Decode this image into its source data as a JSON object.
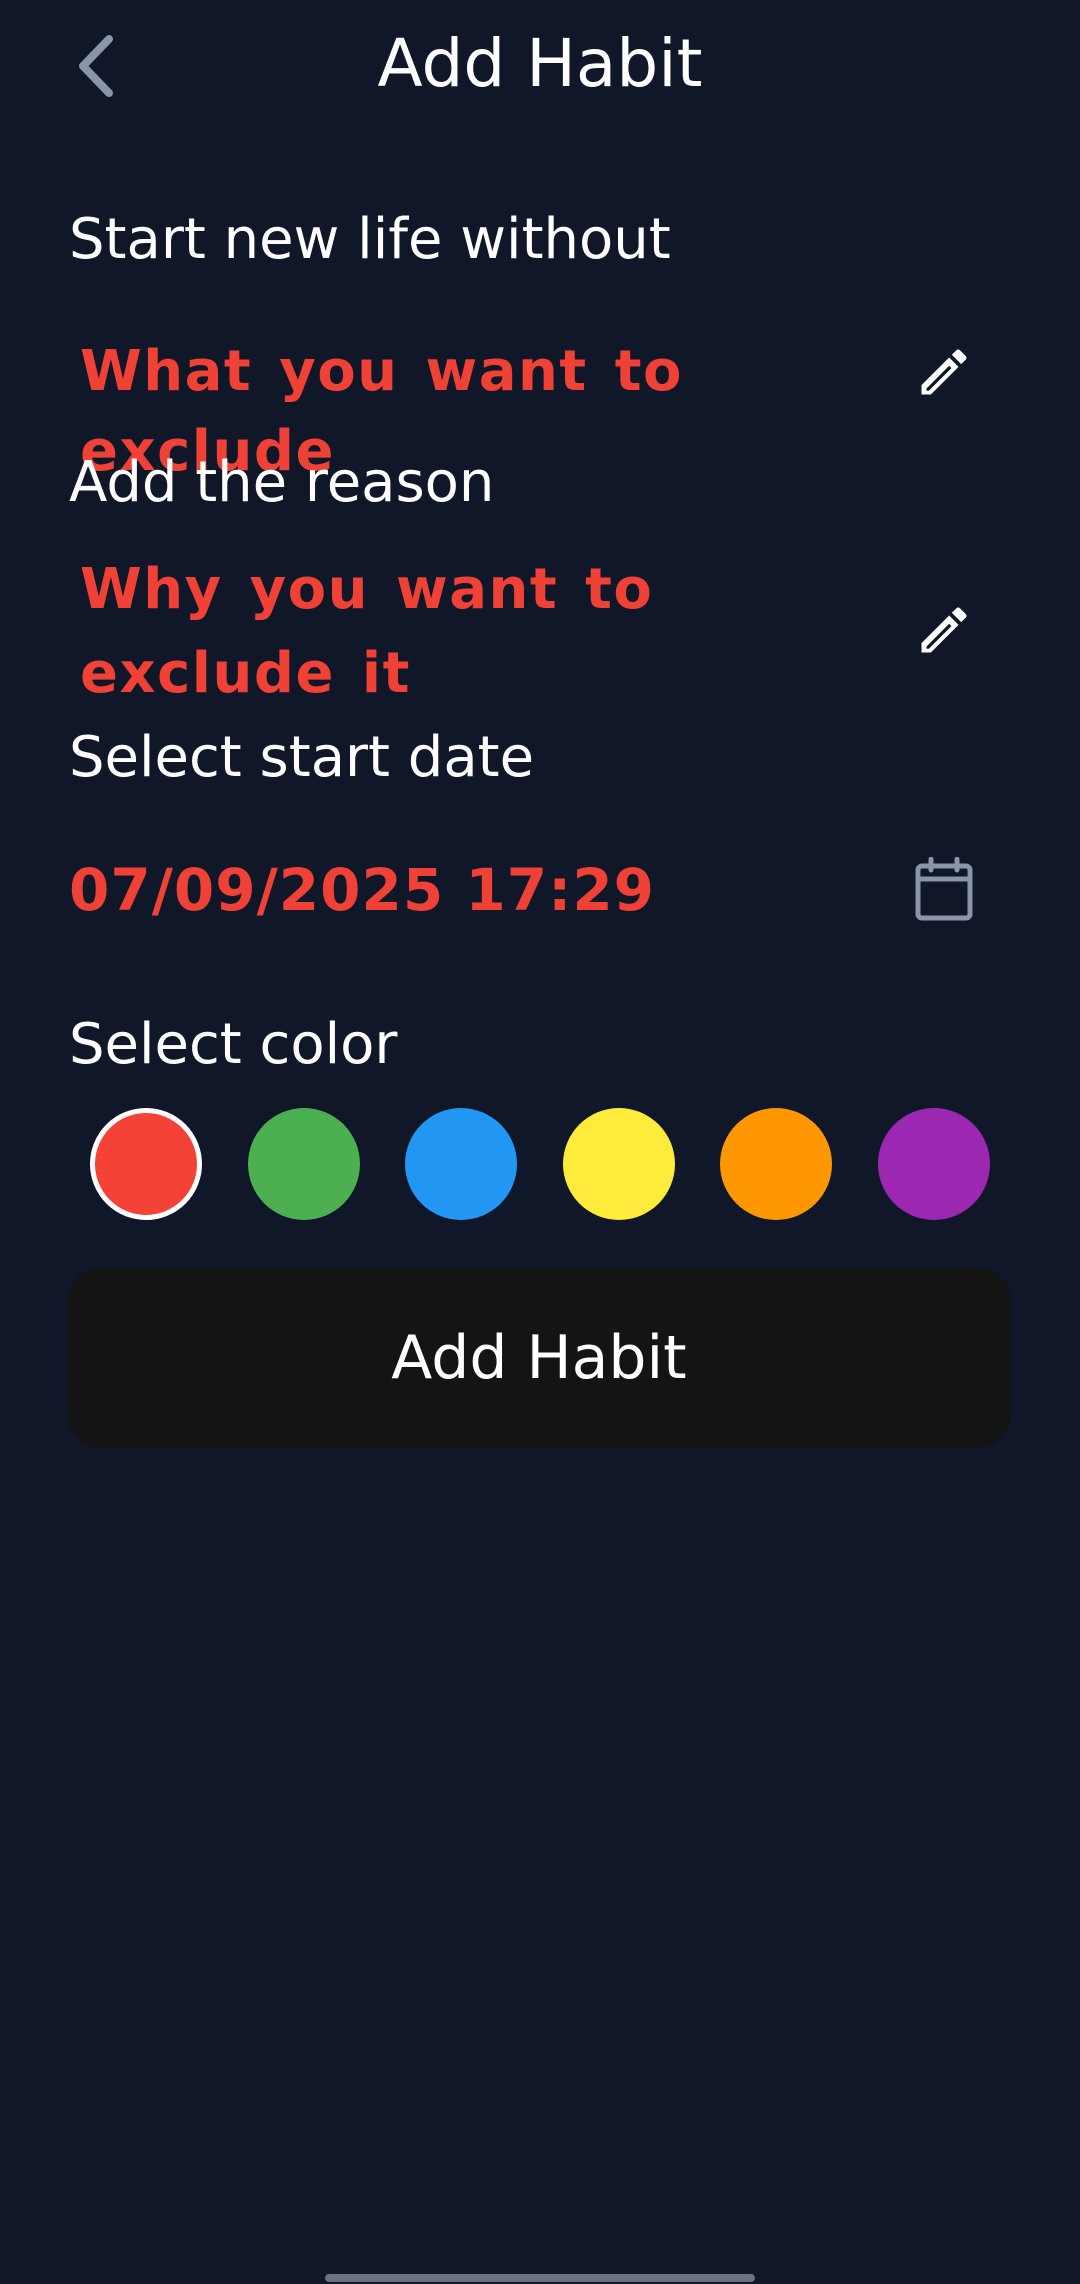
{
  "header": {
    "back_icon": "chevron-left-icon",
    "title": "Add Habit"
  },
  "exclude": {
    "label": "Start new life without",
    "placeholder": "What you want to exclude",
    "icon": "pencil-icon"
  },
  "reason": {
    "label": "Add the reason",
    "placeholder": "Why you want to exclude it",
    "icon": "pencil-icon"
  },
  "start_date": {
    "label": "Select start date",
    "value": "07/09/2025 17:29",
    "icon": "calendar-icon"
  },
  "color": {
    "label": "Select color",
    "selected": "red",
    "options": [
      {
        "name": "red",
        "hex": "#F44336"
      },
      {
        "name": "green",
        "hex": "#4CAF50"
      },
      {
        "name": "blue",
        "hex": "#2196F3"
      },
      {
        "name": "yellow",
        "hex": "#FFEB3B"
      },
      {
        "name": "orange",
        "hex": "#FF9800"
      },
      {
        "name": "purple",
        "hex": "#9C27B0"
      }
    ]
  },
  "actions": {
    "add_label": "Add Habit"
  },
  "theme": {
    "background": "#101729",
    "accent": "#EF4136",
    "button_bg": "#141414"
  }
}
